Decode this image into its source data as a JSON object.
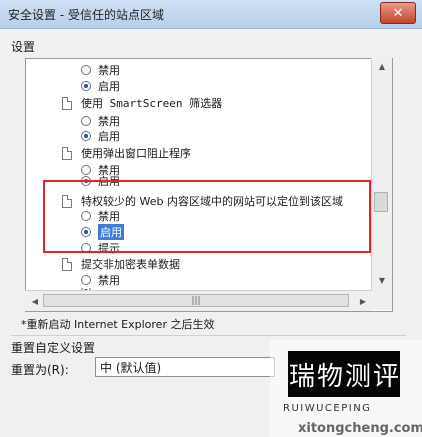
{
  "window": {
    "title": "安全设置 - 受信任的站点区域",
    "close_glyph": "✕"
  },
  "settings_label": "设置",
  "list": {
    "rows": [
      {
        "type": "option",
        "label": "禁用",
        "selected": false
      },
      {
        "type": "option",
        "label": "启用",
        "selected": true
      },
      {
        "type": "setting",
        "label": "使用 SmartScreen 筛选器"
      },
      {
        "type": "option",
        "label": "禁用",
        "selected": false
      },
      {
        "type": "option",
        "label": "启用",
        "selected": true
      },
      {
        "type": "setting",
        "label": "使用弹出窗口阻止程序"
      },
      {
        "type": "option",
        "label": "禁用",
        "selected": false
      },
      {
        "type": "option",
        "label": "启用",
        "selected": true
      },
      {
        "type": "setting",
        "label": "特权较少的 Web 内容区域中的网站可以定位到该区域"
      },
      {
        "type": "option",
        "label": "禁用",
        "selected": false
      },
      {
        "type": "option",
        "label": "启用",
        "selected": true
      },
      {
        "type": "option",
        "label": "提示",
        "selected": false
      },
      {
        "type": "setting",
        "label": "提交非加密表单数据"
      },
      {
        "type": "option",
        "label": "禁用",
        "selected": false
      }
    ]
  },
  "restart_note": "*重新启动 Internet Explorer 之后生效",
  "reset": {
    "section_title": "重置自定义设置",
    "label": "重置为(R):",
    "value": "中 (默认值)"
  },
  "watermark": {
    "chars": [
      "瑞",
      "物",
      "测",
      "评"
    ],
    "sub": "RUIWUCEPING",
    "url": "xitongcheng.com"
  }
}
